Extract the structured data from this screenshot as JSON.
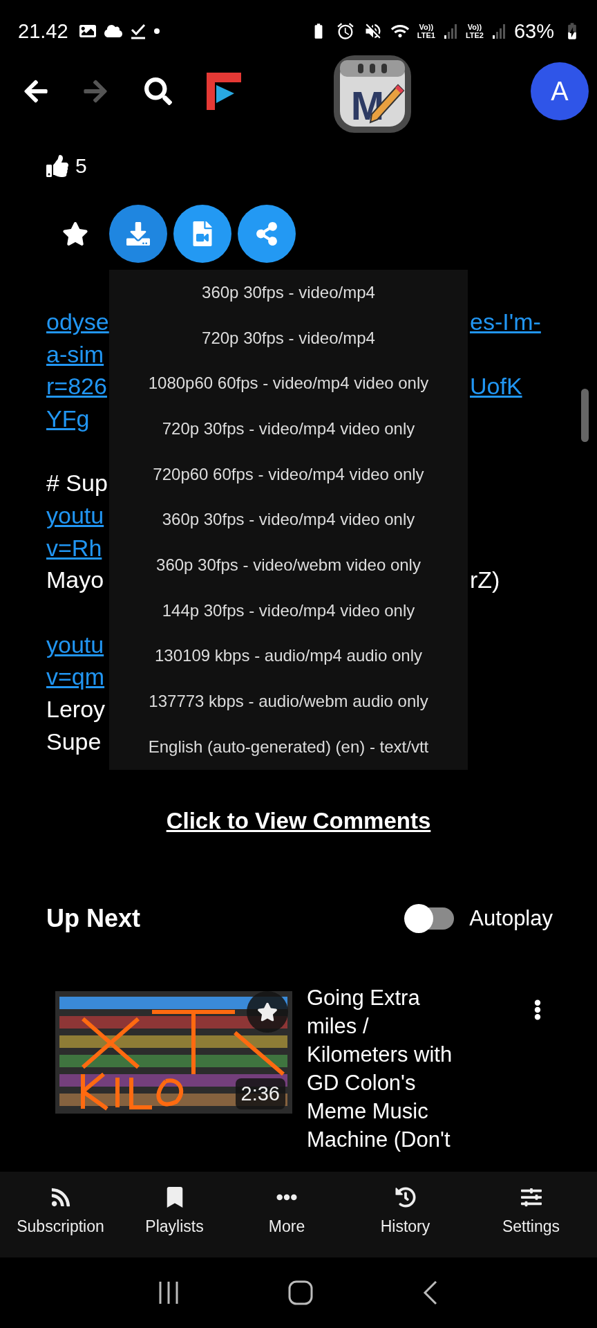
{
  "status_bar": {
    "time": "21.42",
    "networks": [
      {
        "voice": "Vo))",
        "label": "LTE1"
      },
      {
        "voice": "Vo))",
        "label": "LTE2"
      }
    ],
    "battery": "63%"
  },
  "toolbar": {
    "app_letter": "M",
    "avatar_letter": "A"
  },
  "video": {
    "likes": "5"
  },
  "actions": [
    {
      "kind": "favorite",
      "selected": false
    },
    {
      "kind": "download",
      "selected": true
    },
    {
      "kind": "file",
      "selected": false
    },
    {
      "kind": "share",
      "selected": false
    }
  ],
  "download_menu": {
    "items": [
      "360p 30fps - video/mp4",
      "720p 30fps - video/mp4",
      "1080p60 60fps - video/mp4 video only",
      "720p 30fps - video/mp4 video only",
      "720p60 60fps - video/mp4 video only",
      "360p 30fps - video/mp4 video only",
      "360p 30fps - video/webm video only",
      "144p 30fps - video/mp4 video only",
      "130109 kbps - audio/mp4 audio only",
      "137773 kbps - audio/webm audio only",
      "English (auto-generated) (en) - text/vtt"
    ]
  },
  "description": {
    "paragraphs": [
      {
        "lines": [
          {
            "left": {
              "text": "odyse",
              "kind": "link"
            },
            "right": {
              "text": "es-I'm-",
              "kind": "link"
            }
          },
          {
            "left": {
              "text": "a-sim",
              "kind": "link"
            }
          },
          {
            "left": {
              "text": "r=826",
              "kind": "link"
            },
            "right": {
              "text": "UofK",
              "kind": "link"
            }
          },
          {
            "left": {
              "text": "YFg",
              "kind": "link"
            }
          }
        ]
      },
      {
        "lines": [
          {
            "left": {
              "text": "# Sup",
              "kind": "plain"
            }
          },
          {
            "left": {
              "text": "youtu",
              "kind": "link"
            }
          },
          {
            "left": {
              "text": "v=Rh",
              "kind": "link"
            }
          },
          {
            "left": {
              "text": "Mayo",
              "kind": "plain"
            },
            "right": {
              "text": "rZ)",
              "kind": "plain"
            }
          }
        ]
      },
      {
        "lines": [
          {
            "left": {
              "text": "youtu",
              "kind": "link"
            }
          },
          {
            "left": {
              "text": "v=qm",
              "kind": "link"
            }
          },
          {
            "left": {
              "text": "Leroy",
              "kind": "plain"
            }
          },
          {
            "left": {
              "text": "Supe",
              "kind": "plain"
            }
          }
        ]
      }
    ]
  },
  "comments_link": "Click to View Comments",
  "up_next": {
    "title": "Up Next",
    "autoplay": {
      "label": "Autoplay",
      "on": false
    },
    "videos": [
      {
        "title": "Going Extra miles / Kilometers with GD Colon's Meme Music Machine (Don't",
        "duration": "2:36"
      }
    ]
  },
  "bottom_nav": [
    {
      "label": "Subscription"
    },
    {
      "label": "Playlists"
    },
    {
      "label": "More"
    },
    {
      "label": "History"
    },
    {
      "label": "Settings"
    }
  ]
}
